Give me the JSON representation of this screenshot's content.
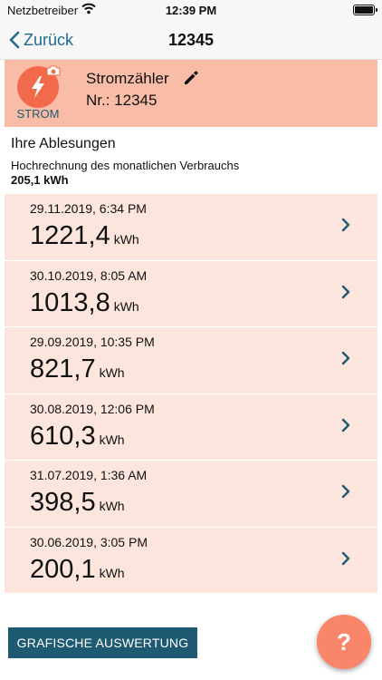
{
  "status_bar": {
    "carrier": "Netzbetreiber",
    "time": "12:39 PM"
  },
  "nav": {
    "back_label": "Zurück",
    "title": "12345"
  },
  "meter": {
    "type_label": "STROM",
    "name": "Stromzähler",
    "number": "Nr.: 12345"
  },
  "summary": {
    "heading": "Ihre Ablesungen",
    "projection_label": "Hochrechnung des monatlichen Verbrauchs",
    "projection_value": "205,1 kWh"
  },
  "readings": [
    {
      "date": "29.11.2019, 6:34 PM",
      "value": "1221,4",
      "unit": "kWh"
    },
    {
      "date": "30.10.2019, 8:05 AM",
      "value": "1013,8",
      "unit": "kWh"
    },
    {
      "date": "29.09.2019, 10:35 PM",
      "value": "821,7",
      "unit": "kWh"
    },
    {
      "date": "30.08.2019, 12:06 PM",
      "value": "610,3",
      "unit": "kWh"
    },
    {
      "date": "31.07.2019, 1:36 AM",
      "value": "398,5",
      "unit": "kWh"
    },
    {
      "date": "30.06.2019, 3:05 PM",
      "value": "200,1",
      "unit": "kWh"
    }
  ],
  "actions": {
    "chart_button": "GRAFISCHE AUSWERTUNG",
    "help_button": "?"
  },
  "colors": {
    "accent": "#1f5a73",
    "header_bg": "#f9bca7",
    "row_bg": "#fbe5dd",
    "icon_bg": "#f26a4b",
    "help_bg": "#f9866a"
  },
  "icons": {
    "wifi": "wifi-icon",
    "battery": "battery-icon",
    "back": "chevron-left-icon",
    "camera": "camera-icon",
    "bolt": "lightning-icon",
    "edit": "pencil-icon",
    "row": "chevron-right-icon"
  }
}
